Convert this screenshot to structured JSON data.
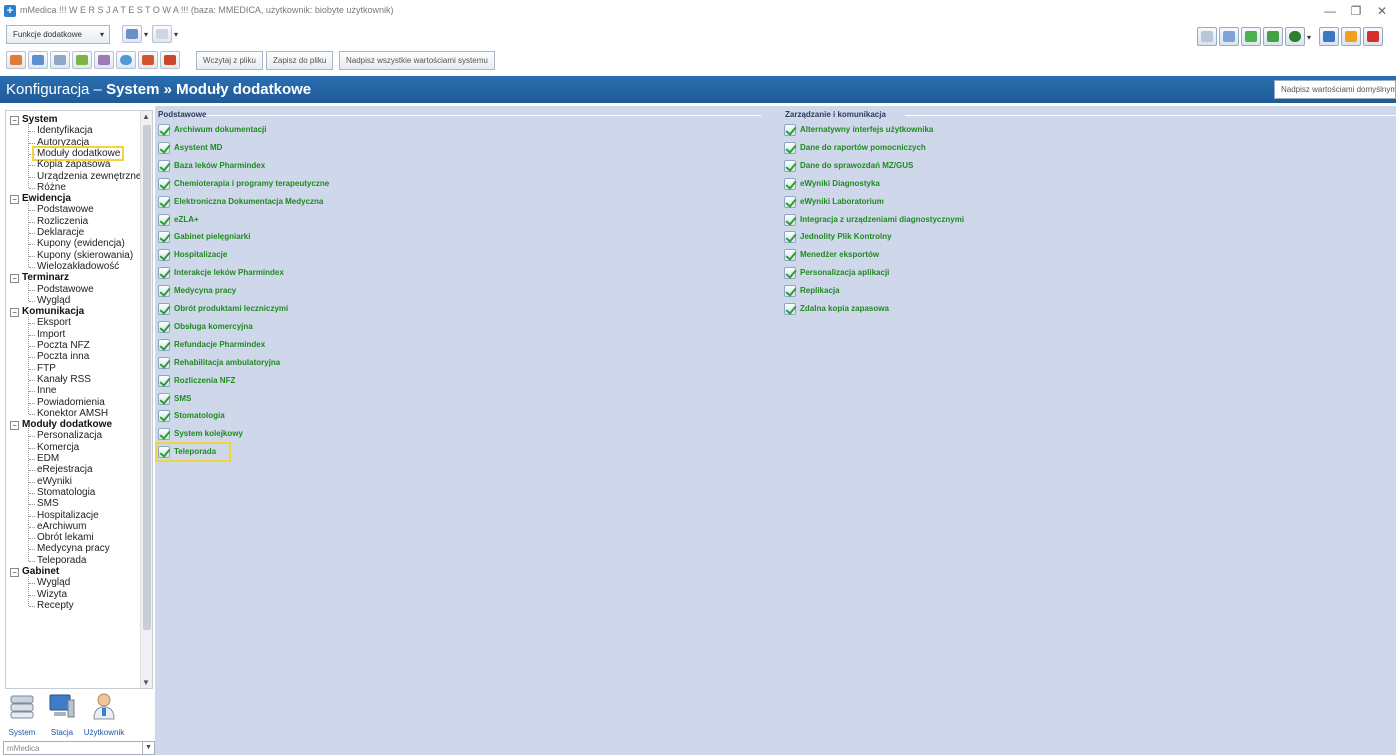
{
  "window": {
    "title": "mMedica !!! W E R S J A T E S T O W A !!! (baza: MMEDICA, użytkownik: biobyte użytkownik)"
  },
  "toolbar": {
    "functions_label": "Funkcje dodatkowe",
    "load_file": "Wczytaj z pliku",
    "save_file": "Zapisz do pliku",
    "overwrite_all": "Nadpisz wszystkie wartościami systemu"
  },
  "header": {
    "prefix": "Konfiguracja – ",
    "section": "System",
    "separator": " » ",
    "page": "Moduły dodatkowe",
    "defaults_button": "Nadpisz wartościami domyślnymi"
  },
  "tree": {
    "groups": [
      {
        "label": "System",
        "items": [
          "Identyfikacja",
          "Autoryzacja",
          "Moduły dodatkowe",
          "Kopia zapasowa",
          "Urządzenia zewnętrzne",
          "Różne"
        ]
      },
      {
        "label": "Ewidencja",
        "items": [
          "Podstawowe",
          "Rozliczenia",
          "Deklaracje",
          "Kupony (ewidencja)",
          "Kupony (skierowania)",
          "Wielozakładowość"
        ]
      },
      {
        "label": "Terminarz",
        "items": [
          "Podstawowe",
          "Wygląd"
        ]
      },
      {
        "label": "Komunikacja",
        "items": [
          "Eksport",
          "Import",
          "Poczta NFZ",
          "Poczta inna",
          "FTP",
          "Kanały RSS",
          "Inne",
          "Powiadomienia",
          "Konektor AMSH"
        ]
      },
      {
        "label": "Moduły dodatkowe",
        "items": [
          "Personalizacja",
          "Komercja",
          "EDM",
          "eRejestracja",
          "eWyniki",
          "Stomatologia",
          "SMS",
          "Hospitalizacje",
          "eArchiwum",
          "Obrót lekami",
          "Medycyna pracy",
          "Teleporada"
        ]
      },
      {
        "label": "Gabinet",
        "items": [
          "Wygląd",
          "Wizyta",
          "Recepty"
        ]
      }
    ]
  },
  "nav": {
    "system": "System",
    "station": "Stacja",
    "user": "Użytkownik",
    "station_select": "mMedica"
  },
  "main": {
    "basic": {
      "title": "Podstawowe",
      "modules": [
        "Archiwum dokumentacji",
        "Asystent MD",
        "Baza leków Pharmindex",
        "Chemioterapia i programy terapeutyczne",
        "Elektroniczna Dokumentacja Medyczna",
        "eZLA+",
        "Gabinet pielęgniarki",
        "Hospitalizacje",
        "Interakcje leków Pharmindex",
        "Medycyna pracy",
        "Obrót produktami leczniczymi",
        "Obsługa komercyjna",
        "Refundacje Pharmindex",
        "Rehabilitacja ambulatoryjna",
        "Rozliczenia NFZ",
        "SMS",
        "Stomatologia",
        "System kolejkowy",
        "Teleporada"
      ]
    },
    "management": {
      "title": "Zarządzanie i komunikacja",
      "modules": [
        "Alternatywny interfejs użytkownika",
        "Dane do raportów pomocniczych",
        "Dane do sprawozdań MZ/GUS",
        "eWyniki Diagnostyka",
        "eWyniki Laboratorium",
        "Integracja z urządzeniami diagnostycznymi",
        "Jednolity Plik Kontrolny",
        "Menedżer eksportów",
        "Personalizacja aplikacji",
        "Replikacja",
        "Zdalna kopia zapasowa"
      ]
    }
  },
  "colors": {
    "header_bg": "#1e5a98",
    "content_bg": "#cfd8ea",
    "module_text": "#1f8a1f",
    "highlight": "#f2d53c"
  }
}
